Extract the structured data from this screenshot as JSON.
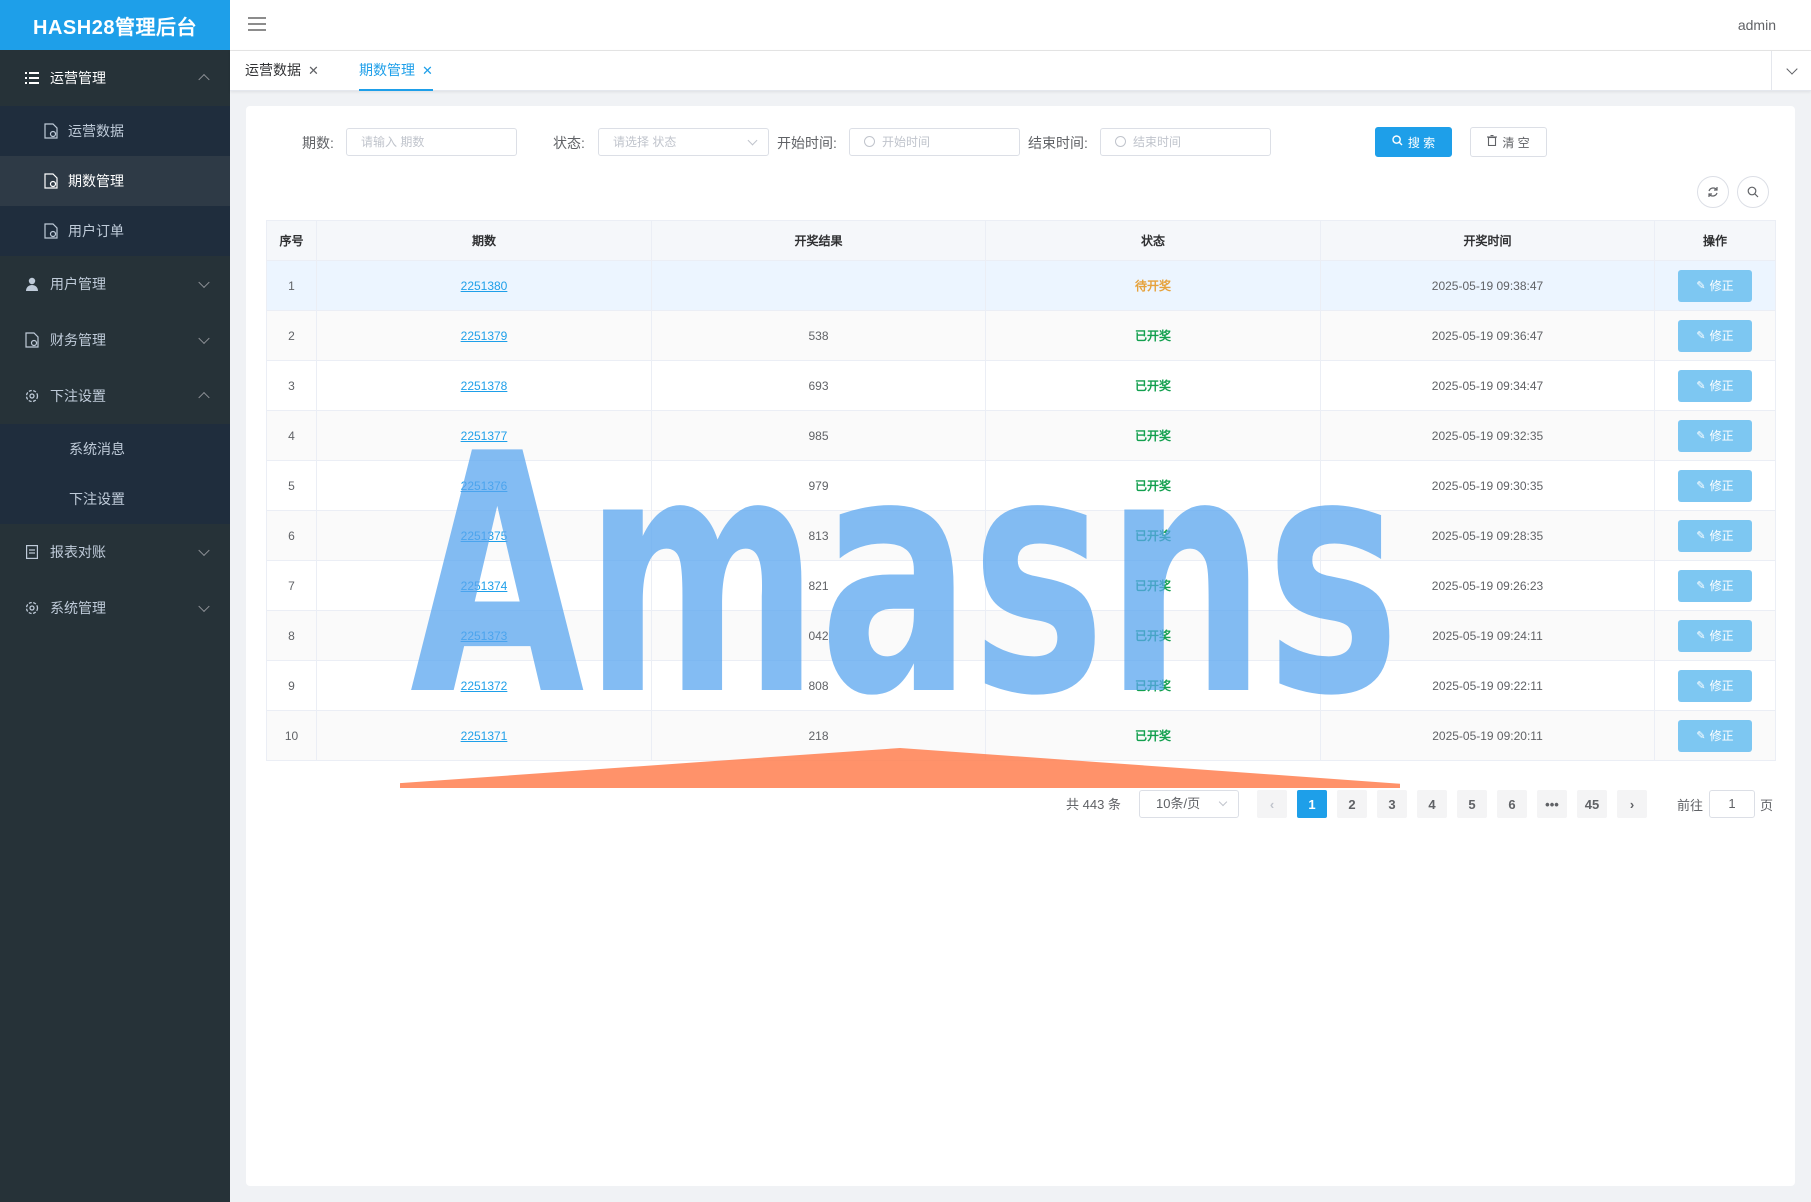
{
  "app": {
    "title": "HASH28管理后台",
    "user": "admin"
  },
  "sidebar": {
    "groups": [
      {
        "label": "运营管理",
        "expanded": true,
        "items": [
          {
            "label": "运营数据",
            "active": false
          },
          {
            "label": "期数管理",
            "active": true
          },
          {
            "label": "用户订单",
            "active": false
          }
        ]
      },
      {
        "label": "用户管理",
        "expanded": false
      },
      {
        "label": "财务管理",
        "expanded": false
      },
      {
        "label": "下注设置",
        "expanded": true,
        "items": [
          {
            "label": "系统消息"
          },
          {
            "label": "下注设置"
          }
        ]
      },
      {
        "label": "报表对账",
        "expanded": false
      },
      {
        "label": "系统管理",
        "expanded": false
      }
    ]
  },
  "tabs": [
    {
      "label": "运营数据",
      "close": "✕"
    },
    {
      "label": "期数管理",
      "close": "✕",
      "active": true
    }
  ],
  "filters": {
    "issue_label": "期数:",
    "issue_placeholder": "请输入 期数",
    "status_label": "状态:",
    "status_placeholder": "请选择 状态",
    "start_label": "开始时间:",
    "start_placeholder": "开始时间",
    "end_label": "结束时间:",
    "end_placeholder": "结束时间",
    "search_label": "搜 索",
    "clear_label": "清 空"
  },
  "table": {
    "headers": [
      "序号",
      "期数",
      "开奖结果",
      "状态",
      "开奖时间",
      "操作"
    ],
    "edit_label": "修正",
    "rows": [
      {
        "no": "1",
        "issue": "2251380",
        "result": "",
        "status": "待开奖",
        "time": "2025-05-19 09:38:47"
      },
      {
        "no": "2",
        "issue": "2251379",
        "result": "538",
        "status": "已开奖",
        "time": "2025-05-19 09:36:47"
      },
      {
        "no": "3",
        "issue": "2251378",
        "result": "693",
        "status": "已开奖",
        "time": "2025-05-19 09:34:47"
      },
      {
        "no": "4",
        "issue": "2251377",
        "result": "985",
        "status": "已开奖",
        "time": "2025-05-19 09:32:35"
      },
      {
        "no": "5",
        "issue": "2251376",
        "result": "979",
        "status": "已开奖",
        "time": "2025-05-19 09:30:35"
      },
      {
        "no": "6",
        "issue": "2251375",
        "result": "813",
        "status": "已开奖",
        "time": "2025-05-19 09:28:35"
      },
      {
        "no": "7",
        "issue": "2251374",
        "result": "821",
        "status": "已开奖",
        "time": "2025-05-19 09:26:23"
      },
      {
        "no": "8",
        "issue": "2251373",
        "result": "042",
        "status": "已开奖",
        "time": "2025-05-19 09:24:11"
      },
      {
        "no": "9",
        "issue": "2251372",
        "result": "808",
        "status": "已开奖",
        "time": "2025-05-19 09:22:11"
      },
      {
        "no": "10",
        "issue": "2251371",
        "result": "218",
        "status": "已开奖",
        "time": "2025-05-19 09:20:11"
      }
    ]
  },
  "pagination": {
    "total": "共 443 条",
    "page_size": "10条/页",
    "pages": [
      "1",
      "2",
      "3",
      "4",
      "5",
      "6",
      "•••",
      "45"
    ],
    "current": "1",
    "goto_label": "前往",
    "goto_value": "1",
    "goto_suffix": "页"
  },
  "watermark": {
    "text": "Amasns"
  },
  "colors": {
    "accent": "#1e9fe9",
    "sidebar_bg": "#263238",
    "status_pending": "#e6a23c",
    "status_done": "#13a04f",
    "watermark_blue": "#5aa6ef",
    "watermark_orange": "#ff7f50"
  }
}
